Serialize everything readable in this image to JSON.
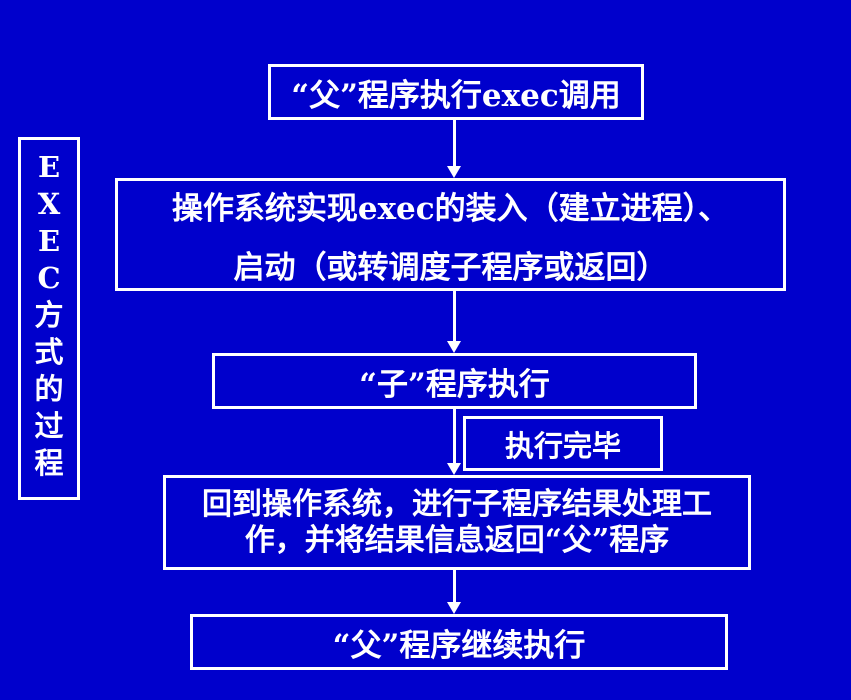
{
  "side_title": [
    "E",
    "X",
    "E",
    "C",
    "方",
    "式",
    "的",
    "过",
    "程"
  ],
  "steps": {
    "parent_call": "“父”程序执行exec调用",
    "os_load_line1": "操作系统实现exec的装入（建立进程）、",
    "os_load_line2": "启动（或转调度子程序或返回）",
    "child_run": "“子”程序执行",
    "done_label": "执行完毕",
    "return_line1": "回到操作系统，进行子程序结果处理工",
    "return_line2": "作，并将结果信息返回“父”程序",
    "parent_continue": "“父”程序继续执行"
  },
  "colors": {
    "background": "#0000cc",
    "foreground": "#ffffff"
  }
}
